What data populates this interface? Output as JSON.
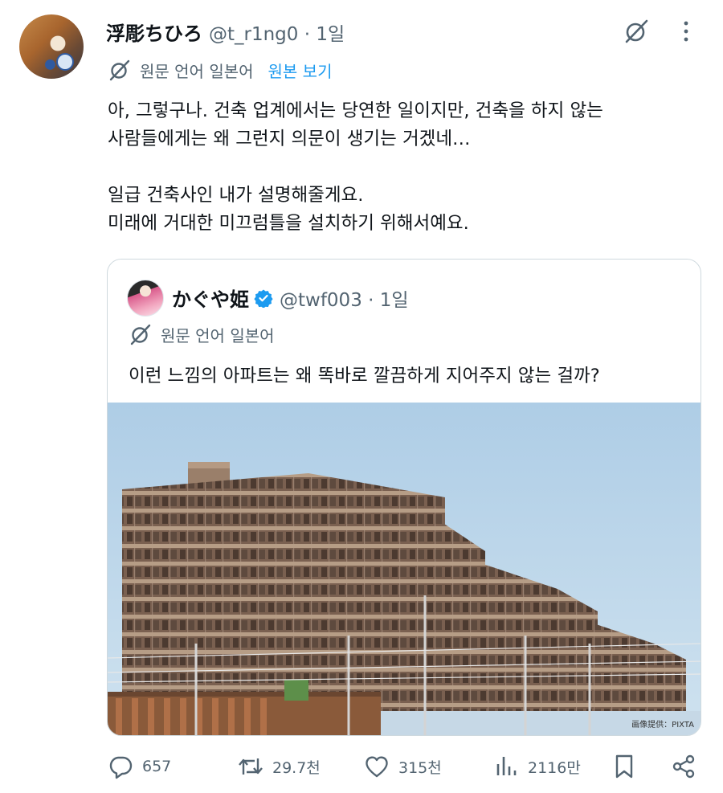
{
  "tweet": {
    "author_name": "浮彫ちひろ",
    "author_handle": "@t_r1ng0 · 1일",
    "translation_label": "원문 언어 일본어",
    "view_original": "원본 보기",
    "body": [
      "아, 그렇구나. 건축 업계에서는 당연한 일이지만, 건축을 하지 않는",
      "사람들에게는 왜 그런지 의문이 생기는 거겠네…",
      "",
      "일급 건축사인 내가 설명해줄게요.",
      "미래에 거대한 미끄럼틀을 설치하기 위해서예요."
    ]
  },
  "quote": {
    "author_name": "かぐや姫",
    "author_handle": "@twf003 · 1일",
    "translation_label": "원문 언어 일본어",
    "text": "이런 느낌의 아파트는 왜 똑바로 깔끔하게 지어주지 않는 걸까?",
    "image_credit": "画像提供：PIXTA"
  },
  "stats": {
    "replies": "657",
    "reposts": "29.7천",
    "likes": "315천",
    "views": "2116만"
  },
  "icons": [
    "grok-icon",
    "more-icon",
    "translate-icon",
    "verified-icon",
    "reply-icon",
    "repost-icon",
    "like-icon",
    "views-icon",
    "bookmark-icon",
    "share-icon"
  ],
  "colors": {
    "accent": "#1d9bf0",
    "secondary_text": "#536471",
    "border": "#cfd9de"
  }
}
